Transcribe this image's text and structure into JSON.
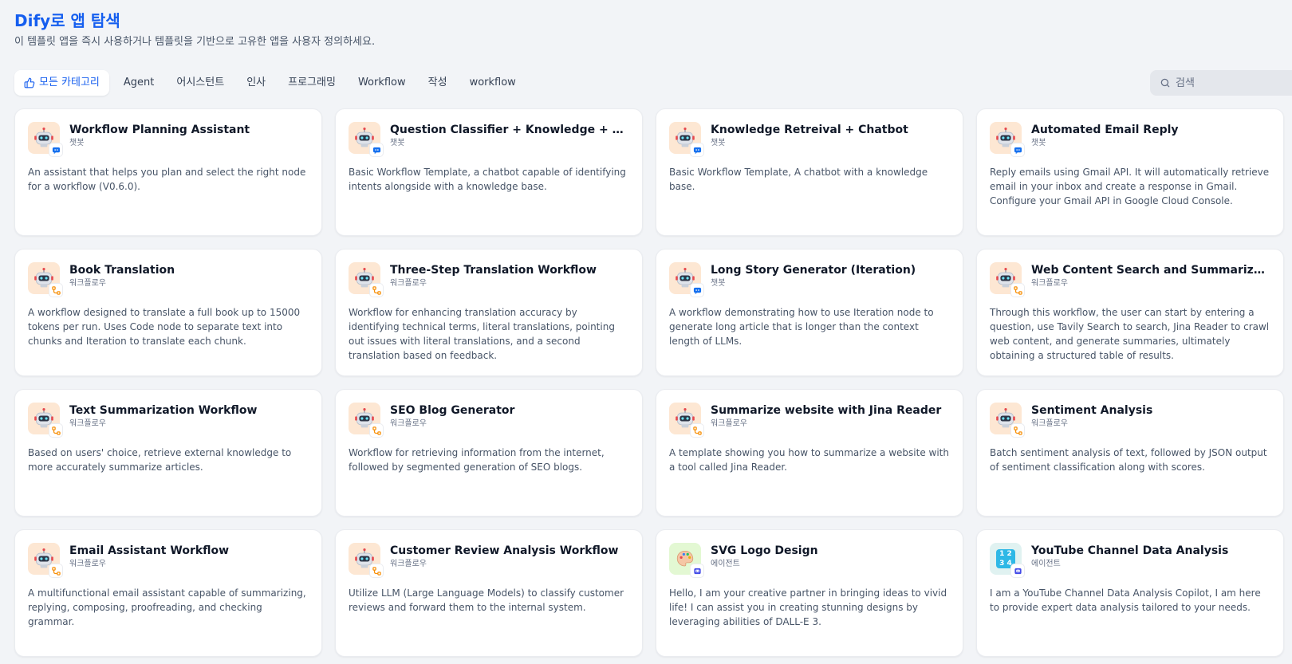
{
  "header": {
    "title": "Dify로 앱 탐색",
    "subtitle": "이 템플릿 앱을 즉시 사용하거나 템플릿을 기반으로 고유한 앱을 사용자 정의하세요."
  },
  "tabs": [
    {
      "label": "모든 카테고리",
      "active": true
    },
    {
      "label": "Agent"
    },
    {
      "label": "어시스턴트"
    },
    {
      "label": "인사"
    },
    {
      "label": "프로그래밍"
    },
    {
      "label": "Workflow"
    },
    {
      "label": "작성"
    },
    {
      "label": "workflow"
    }
  ],
  "search": {
    "placeholder": "검색",
    "value": ""
  },
  "colors": {
    "accent": "#155eef",
    "page_bg": "#f2f4f7",
    "chat_badge": "#1570ef",
    "workflow_badge": "#f79009",
    "agent_badge": "#444ce7"
  },
  "cards": [
    {
      "title": "Workflow Planning Assistant",
      "type": "챗봇",
      "icon": "robot-icon",
      "badge": "chat",
      "description": "An assistant that helps you plan and select the right node for a workflow (V0.6.0)."
    },
    {
      "title": "Question Classifier + Knowledge + Chatbot",
      "type": "챗봇",
      "icon": "robot-icon",
      "badge": "chat",
      "description": "Basic Workflow Template, a chatbot capable of identifying intents alongside with a knowledge base."
    },
    {
      "title": "Knowledge Retreival + Chatbot",
      "type": "챗봇",
      "icon": "robot-icon",
      "badge": "chat",
      "description": "Basic Workflow Template, A chatbot with a knowledge base."
    },
    {
      "title": "Automated Email Reply",
      "type": "챗봇",
      "icon": "robot-icon",
      "badge": "chat",
      "description": "Reply emails using Gmail API. It will automatically retrieve email in your inbox and create a response in Gmail. Configure your Gmail API in Google Cloud Console."
    },
    {
      "title": "Book Translation",
      "type": "워크플로우",
      "icon": "robot-icon",
      "badge": "workflow",
      "description": "A workflow designed to translate a full book up to 15000 tokens per run. Uses Code node to separate text into chunks and Iteration to translate each chunk."
    },
    {
      "title": "Three-Step Translation Workflow",
      "type": "워크플로우",
      "icon": "robot-icon",
      "badge": "workflow",
      "description": "Workflow for enhancing translation accuracy by identifying technical terms, literal translations, pointing out issues with literal translations, and a second translation based on feedback."
    },
    {
      "title": "Long Story Generator (Iteration)",
      "type": "챗봇",
      "icon": "robot-icon",
      "badge": "chat",
      "description": "A workflow demonstrating how to use Iteration node to generate long article that is longer than the context length of LLMs."
    },
    {
      "title": "Web Content Search and Summarization Workflow",
      "type": "워크플로우",
      "icon": "robot-icon",
      "badge": "workflow",
      "description": "Through this workflow, the user can start by entering a question, use Tavily Search to search, Jina Reader to crawl web content, and generate summaries, ultimately obtaining a structured table of results."
    },
    {
      "title": "Text Summarization Workflow",
      "type": "워크플로우",
      "icon": "robot-icon",
      "badge": "workflow",
      "description": "Based on users' choice, retrieve external knowledge to more accurately summarize articles."
    },
    {
      "title": "SEO Blog Generator",
      "type": "워크플로우",
      "icon": "robot-icon",
      "badge": "workflow",
      "description": "Workflow for retrieving information from the internet, followed by segmented generation of SEO blogs."
    },
    {
      "title": "Summarize website with Jina Reader",
      "type": "워크플로우",
      "icon": "robot-icon",
      "badge": "workflow",
      "description": "A template showing you how to summarize a website with a tool called Jina Reader."
    },
    {
      "title": "Sentiment Analysis",
      "type": "워크플로우",
      "icon": "robot-icon",
      "badge": "workflow",
      "description": "Batch sentiment analysis of text, followed by JSON output of sentiment classification along with scores."
    },
    {
      "title": "Email Assistant Workflow",
      "type": "워크플로우",
      "icon": "robot-icon",
      "badge": "workflow",
      "description": "A multifunctional email assistant capable of summarizing, replying, composing, proofreading, and checking grammar."
    },
    {
      "title": "Customer Review Analysis Workflow",
      "type": "워크플로우",
      "icon": "robot-icon",
      "badge": "workflow",
      "description": "Utilize LLM (Large Language Models) to classify customer reviews and forward them to the internal system."
    },
    {
      "title": "SVG Logo Design",
      "type": "에이전트",
      "icon": "palette-icon",
      "badge": "agent",
      "description": "Hello, I am your creative partner in bringing ideas to vivid life! I can assist you in creating stunning designs by leveraging abilities of DALL-E 3."
    },
    {
      "title": "YouTube Channel Data Analysis",
      "type": "에이전트",
      "icon": "numbers-icon",
      "badge": "agent",
      "description": "I am a YouTube Channel Data Analysis Copilot, I am here to provide expert data analysis tailored to your needs."
    }
  ]
}
